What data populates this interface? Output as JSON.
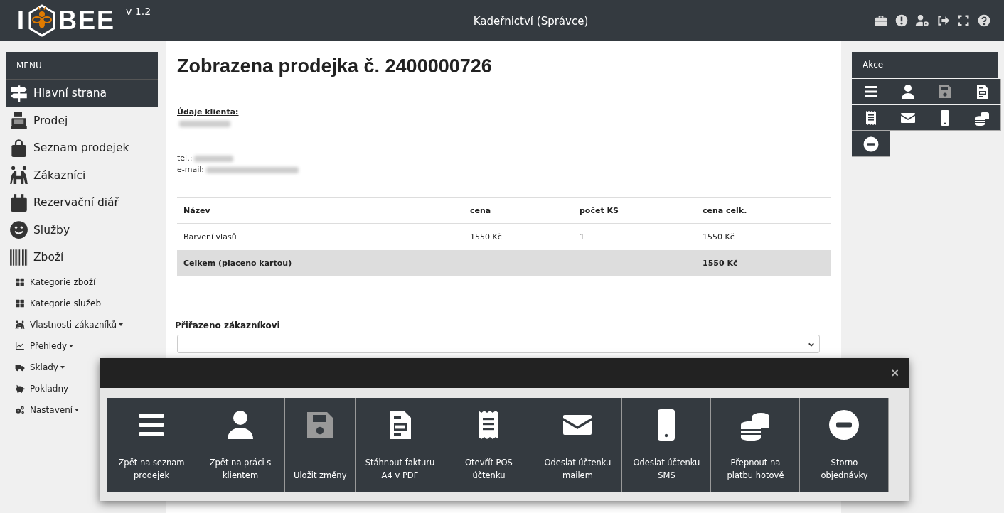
{
  "header": {
    "logo_left": "I",
    "logo_right": "BEE",
    "version": "v 1.2",
    "title": "Kadeřnictví (Správce)"
  },
  "sidebar": {
    "title": "MENU",
    "items": [
      {
        "label": "Hlavní strana",
        "kind": "main",
        "selected": true
      },
      {
        "label": "Prodej",
        "kind": "main",
        "selected": false
      },
      {
        "label": "Seznam prodejek",
        "kind": "main",
        "selected": false
      },
      {
        "label": "Zákazníci",
        "kind": "main",
        "selected": false
      },
      {
        "label": "Rezervační diář",
        "kind": "main",
        "selected": false
      },
      {
        "label": "Služby",
        "kind": "main",
        "selected": false
      },
      {
        "label": "Zboží",
        "kind": "main",
        "selected": false
      },
      {
        "label": "Kategorie zboží",
        "kind": "sub",
        "selected": false,
        "dropdown": false
      },
      {
        "label": "Kategorie služeb",
        "kind": "sub",
        "selected": false,
        "dropdown": false
      },
      {
        "label": "Vlastnosti zákazníků",
        "kind": "sub",
        "selected": false,
        "dropdown": true
      },
      {
        "label": "Přehledy",
        "kind": "sub",
        "selected": false,
        "dropdown": true
      },
      {
        "label": "Sklady",
        "kind": "sub",
        "selected": false,
        "dropdown": true
      },
      {
        "label": "Pokladny",
        "kind": "sub",
        "selected": false,
        "dropdown": false
      },
      {
        "label": "Nastavení",
        "kind": "sub",
        "selected": false,
        "dropdown": true
      }
    ]
  },
  "main": {
    "title": "Zobrazena prodejka č. 2400000726",
    "client_heading": "Údaje klienta:",
    "phone_label": "tel.:",
    "email_label": "e-mail:",
    "table": {
      "columns": [
        "Název",
        "cena",
        "počet KS",
        "cena celk."
      ],
      "rows": [
        [
          "Barvení vlasů",
          "1550 Kč",
          "1",
          "1550 Kč"
        ]
      ],
      "total": {
        "label": "Celkem (placeno kartou)",
        "value": "1550 Kč"
      }
    },
    "assigned_label": "Přiřazeno zákazníkovi"
  },
  "actions_panel": {
    "title": "Akce",
    "actions": [
      {
        "disabled": false
      },
      {
        "disabled": false
      },
      {
        "disabled": true
      },
      {
        "disabled": false
      },
      {
        "disabled": false
      },
      {
        "disabled": false
      },
      {
        "disabled": false
      },
      {
        "disabled": false
      },
      {
        "disabled": false
      }
    ]
  },
  "modal": {
    "close": "×",
    "actions": [
      {
        "label": "Zpět na seznam prodejek",
        "disabled": false
      },
      {
        "label": "Zpět na práci s klientem",
        "disabled": false
      },
      {
        "label": "Uložit změny",
        "disabled": true
      },
      {
        "label": "Stáhnout fakturu A4 v PDF",
        "disabled": false
      },
      {
        "label": "Otevřít POS účtenku",
        "disabled": false
      },
      {
        "label": "Odeslat účtenku mailem",
        "disabled": false
      },
      {
        "label": "Odeslat účtenku SMS",
        "disabled": false
      },
      {
        "label": "Přepnout na platbu hotově",
        "disabled": false
      },
      {
        "label": "Storno objednávky",
        "disabled": false
      }
    ]
  }
}
